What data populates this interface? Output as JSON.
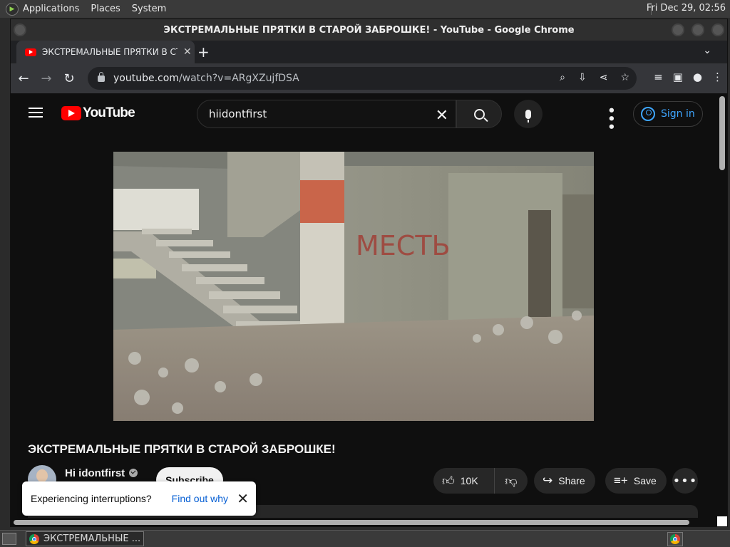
{
  "desktop": {
    "menu": [
      "Applications",
      "Places",
      "System"
    ],
    "clock": "Fri Dec 29, 02:56"
  },
  "window": {
    "title": "ЭКСТРЕМАЛЬНЫЕ ПРЯТКИ В СТАРОЙ ЗАБРОШКЕ! - YouTube - Google Chrome"
  },
  "tab": {
    "title": "ЭКСТРЕМАЛЬНЫЕ ПРЯТКИ В СТАРОЙ ЗАБРОШКЕ!",
    "close": "✕",
    "new_tab": "+"
  },
  "omnibox": {
    "host": "youtube.com",
    "path": "/watch?v=ARgXZujfDSA"
  },
  "youtube": {
    "logo_text": "YouTube",
    "search_value": "hiidontfirst",
    "sign_in": "Sign in",
    "video_title": "ЭКСТРЕМАЛЬНЫЕ ПРЯТКИ В СТАРОЙ ЗАБРОШКЕ!",
    "channel_name": "Hi idontfirst",
    "subscribe": "Subscribe",
    "likes": "10K",
    "share": "Share",
    "save": "Save",
    "graffiti": "МЕСТЬ"
  },
  "toast": {
    "message": "Experiencing interruptions?",
    "link": "Find out why"
  },
  "taskbar": {
    "task_title": "ЭКСТРЕМАЛЬНЫЕ ..."
  },
  "colors": {
    "accent_red": "#ff0000",
    "link_blue": "#3ea6ff",
    "page_bg": "#0f0f0f"
  }
}
